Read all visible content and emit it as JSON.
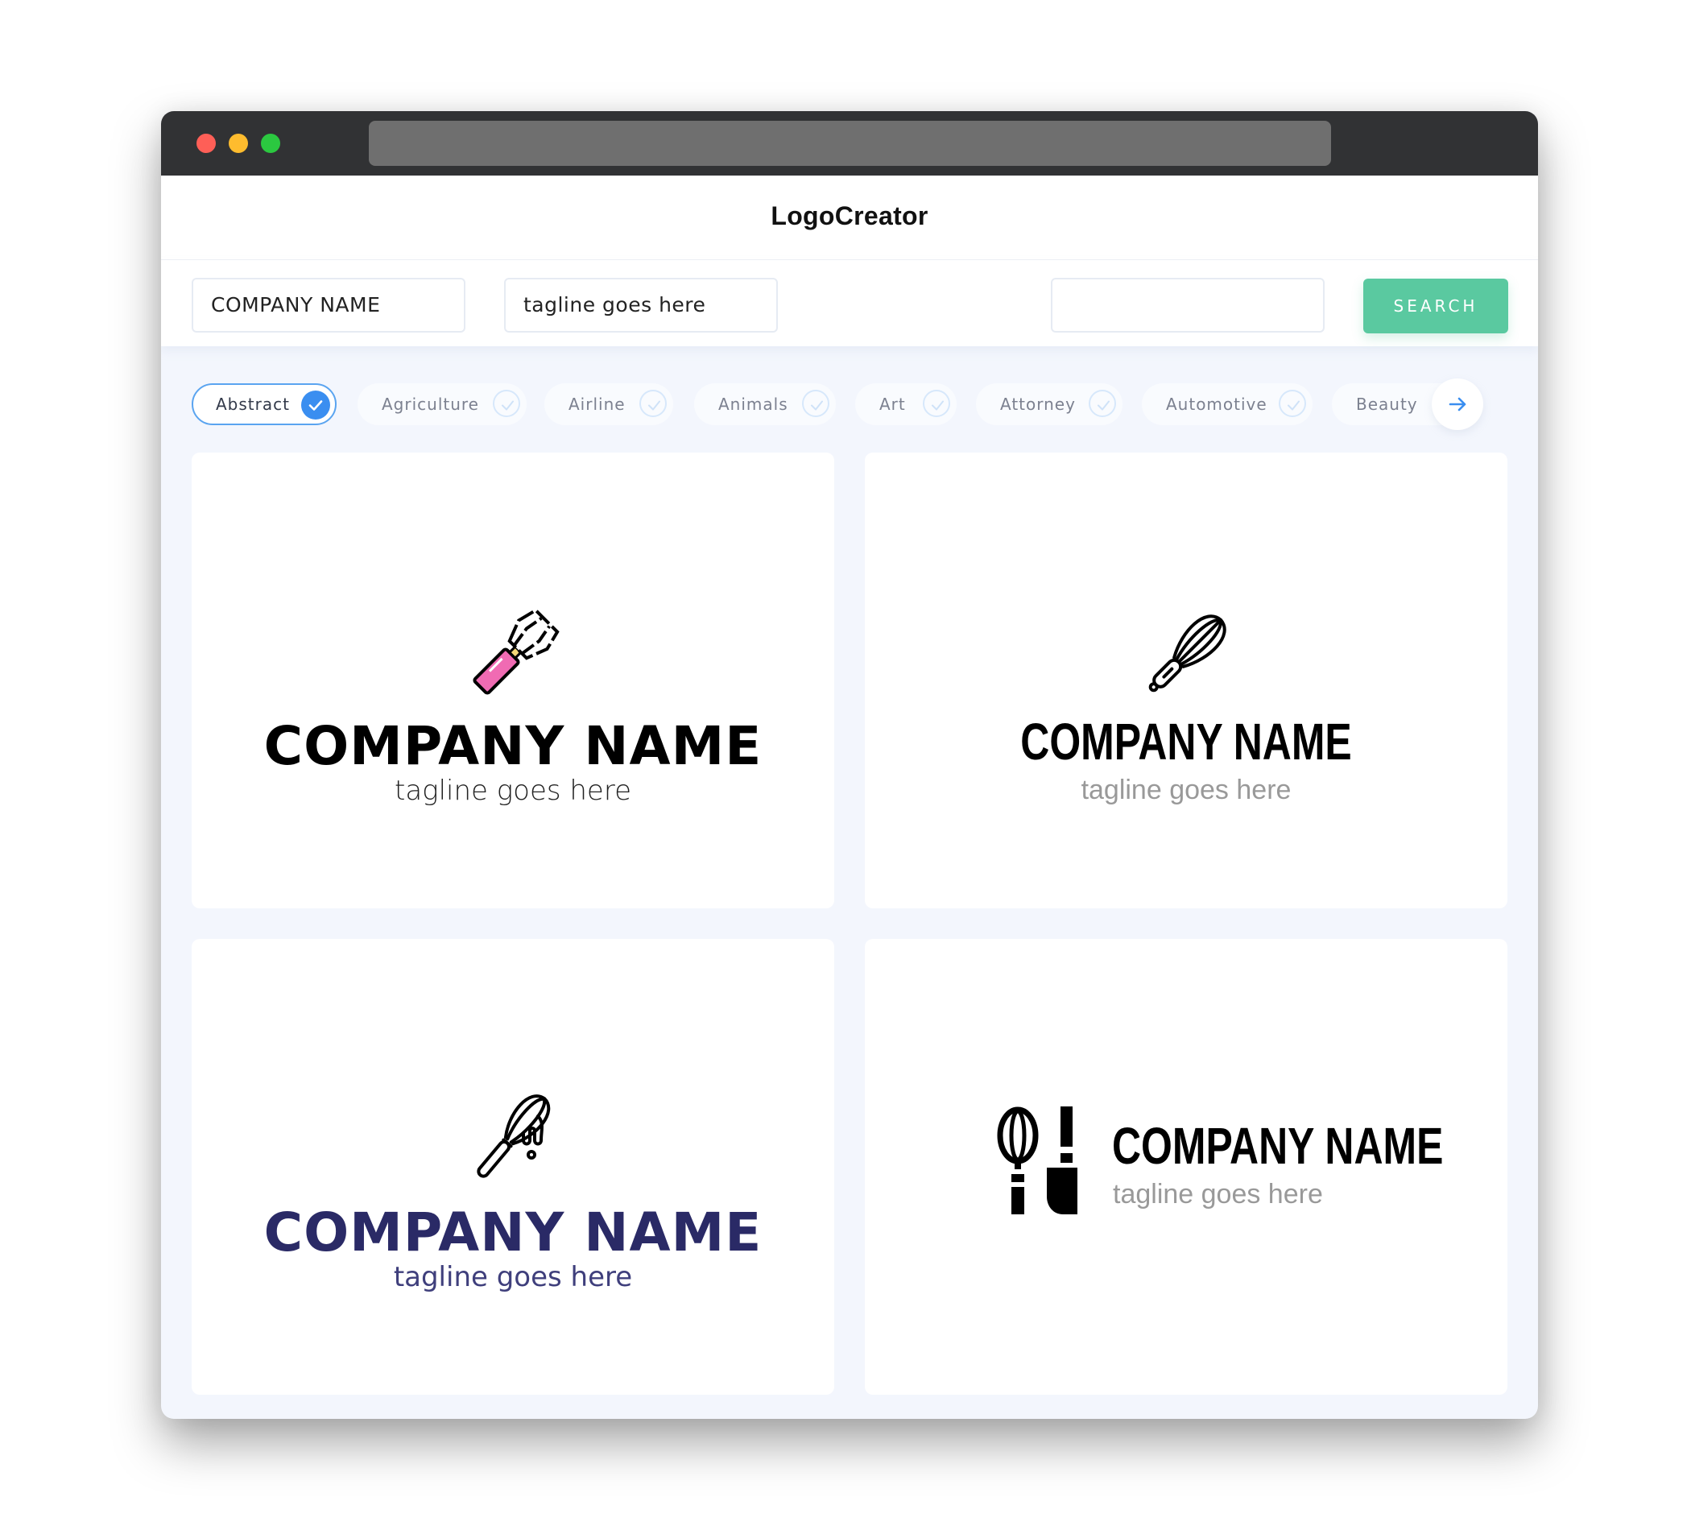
{
  "window": {
    "traffic_lights": [
      "close",
      "minimize",
      "maximize"
    ],
    "colors": {
      "titlebar": "#313234",
      "close": "#fe5f57",
      "minimize": "#febc2e",
      "maximize": "#2bc840"
    }
  },
  "header": {
    "brand": "LogoCreator"
  },
  "inputs": {
    "company_name": {
      "value": "COMPANY NAME"
    },
    "tagline": {
      "value": "tagline goes here"
    },
    "keyword": {
      "value": ""
    },
    "search_label": "SEARCH",
    "search_color": "#5ac9a0"
  },
  "categories": {
    "items": [
      {
        "label": "Abstract",
        "selected": true
      },
      {
        "label": "Agriculture",
        "selected": false
      },
      {
        "label": "Airline",
        "selected": false
      },
      {
        "label": "Animals",
        "selected": false
      },
      {
        "label": "Art",
        "selected": false
      },
      {
        "label": "Attorney",
        "selected": false
      },
      {
        "label": "Automotive",
        "selected": false
      },
      {
        "label": "Beauty",
        "selected": false
      }
    ],
    "next_icon": "arrow-right-icon",
    "accent": "#3a8ef0"
  },
  "logos": [
    {
      "icon": "whisk-pink-handle-icon",
      "company": "COMPANY NAME",
      "tagline": "tagline goes here",
      "name_color": "#000000"
    },
    {
      "icon": "whisk-outline-icon",
      "company": "COMPANY NAME",
      "tagline": "tagline goes here",
      "name_color": "#000000"
    },
    {
      "icon": "whisk-dripping-icon",
      "company": "COMPANY NAME",
      "tagline": "tagline goes here",
      "name_color": "#2a2a66"
    },
    {
      "icon": "whisk-and-knife-icon",
      "company": "COMPANY NAME",
      "tagline": "tagline goes here",
      "name_color": "#000000"
    }
  ]
}
